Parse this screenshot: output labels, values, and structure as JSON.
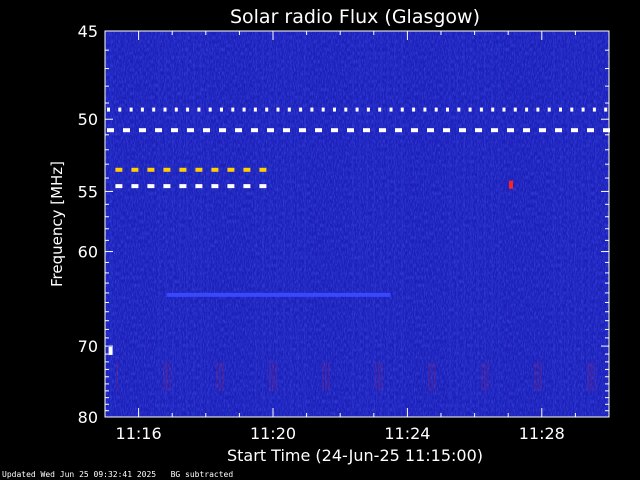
{
  "chart_data": {
    "type": "heatmap",
    "title": "Solar radio Flux (Glasgow)",
    "xlabel": "Start Time (24-Jun-25 11:15:00)",
    "ylabel": "Frequency [MHz]",
    "y_scale": "reciprocal",
    "ylim": [
      45,
      80
    ],
    "xlim": [
      "11:15:00",
      "11:30:00"
    ],
    "y_ticks": [
      45,
      50,
      55,
      60,
      70,
      80
    ],
    "x_ticks": [
      "11:16",
      "11:20",
      "11:24",
      "11:28"
    ],
    "colors": {
      "background": "#1a20b8",
      "foreground": "#ffffff",
      "emission_bright": "#ffffff",
      "emission_mid": "#ff2020",
      "emission_weak": "#ffd000",
      "band_blue": "#3a4bff"
    },
    "features": [
      {
        "kind": "dashed-band",
        "freq_mhz": 49.4,
        "time_start": "11:15:00",
        "time_end": "11:30:00",
        "color": "white"
      },
      {
        "kind": "dashed-band",
        "freq_mhz": 50.7,
        "time_start": "11:15:00",
        "time_end": "11:30:00",
        "color": "white"
      },
      {
        "kind": "dashed-band",
        "freq_mhz": 53.4,
        "time_start": "11:15:15",
        "time_end": "11:19:40",
        "color": "yellow"
      },
      {
        "kind": "dashed-band",
        "freq_mhz": 54.6,
        "time_start": "11:15:15",
        "time_end": "11:19:40",
        "color": "white"
      },
      {
        "kind": "continuous-band",
        "freq_mhz": 64.2,
        "time_start": "11:16:50",
        "time_end": "11:23:30",
        "color": "blue"
      },
      {
        "kind": "spot",
        "freq_mhz": 70.6,
        "time": "11:15:10",
        "color": "white"
      },
      {
        "kind": "spot",
        "freq_mhz": 54.5,
        "time": "11:27:05",
        "color": "red"
      }
    ]
  },
  "footer": {
    "status": "Updated Wed Jun 25 09:32:41 2025   BG subtracted"
  }
}
